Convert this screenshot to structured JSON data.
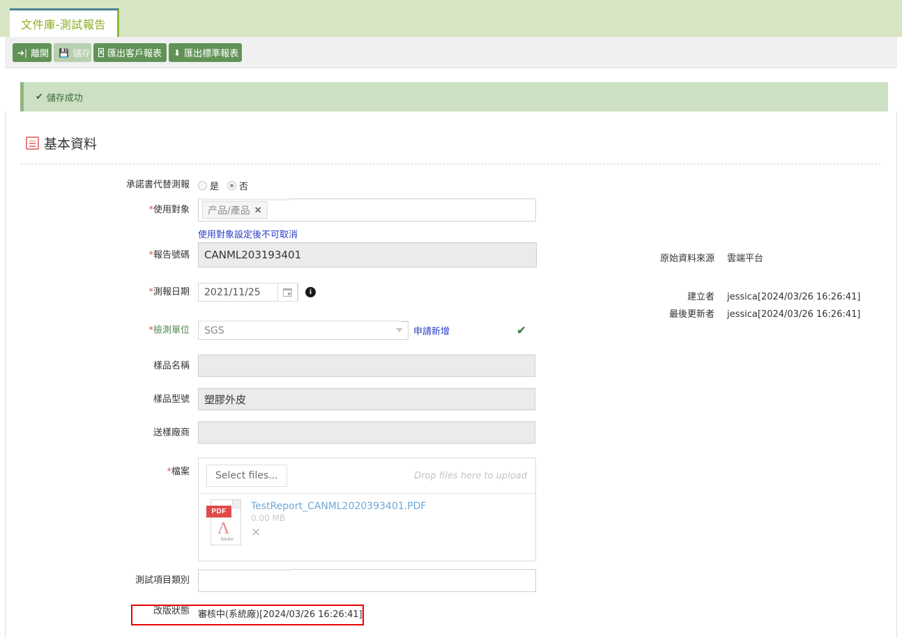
{
  "tab": {
    "label": "文件庫-測試報告"
  },
  "toolbar": {
    "leave_label": "離開",
    "save_label": "儲存",
    "export_customer_label": "匯出客戶報表",
    "export_standard_label": "匯出標準報表",
    "excel_icon_text": "X"
  },
  "alert": {
    "icon": "check-icon",
    "text": "儲存成功"
  },
  "section": {
    "title": "基本資料"
  },
  "form": {
    "pledge": {
      "label": "承諾書代替測報",
      "options": [
        {
          "label": "是",
          "selected": false
        },
        {
          "label": "否",
          "selected": true
        }
      ]
    },
    "usage_target": {
      "label": "使用對象",
      "required": true,
      "chip": "产品/產品",
      "chip_remove": "✕",
      "hint": "使用對象設定後不可取消"
    },
    "report_no": {
      "label": "報告號碼",
      "required": true,
      "value": "CANML203193401"
    },
    "test_date": {
      "label": "測報日期",
      "required": true,
      "value": "2021/11/25",
      "info_icon": "i"
    },
    "test_unit": {
      "label": "檢測單位",
      "required": true,
      "value": "SGS",
      "apply_link": "申請新增",
      "status_icon": "✔"
    },
    "sample_name": {
      "label": "樣品名稱",
      "value": ""
    },
    "sample_model": {
      "label": "樣品型號",
      "value": "塑膠外皮"
    },
    "sample_vendor": {
      "label": "送樣廠商",
      "value": ""
    },
    "files": {
      "label": "檔案",
      "required": true,
      "select_button": "Select files...",
      "drop_hint": "Drop files here to upload",
      "items": [
        {
          "name": "TestReport_CANML2020393401.PDF",
          "size": "0.00 MB",
          "type_badge": "PDF",
          "adobe_text": "Adobe",
          "remove": "✕"
        }
      ]
    },
    "test_item_type": {
      "label": "測試項目類別",
      "value": ""
    },
    "revision_status": {
      "label": "改版狀態",
      "value": "審核中(系統廠)[2024/03/26 16:26:41]"
    }
  },
  "meta": {
    "rows": [
      {
        "label": "原始資料來源",
        "value": "雲端平台"
      },
      {
        "label": "建立者",
        "value": "jessica[2024/03/26 16:26:41]"
      },
      {
        "label": "最後更新者",
        "value": "jessica[2024/03/26 16:26:41]"
      }
    ]
  },
  "colors": {
    "brand_green": "#629356",
    "header_green": "#d7e5c4",
    "tab_text": "#8aad1f",
    "alert_bg": "#cce0c3",
    "link_blue": "#2a3cc8",
    "required_red": "#d9534f",
    "highlight_red": "#e60000"
  }
}
